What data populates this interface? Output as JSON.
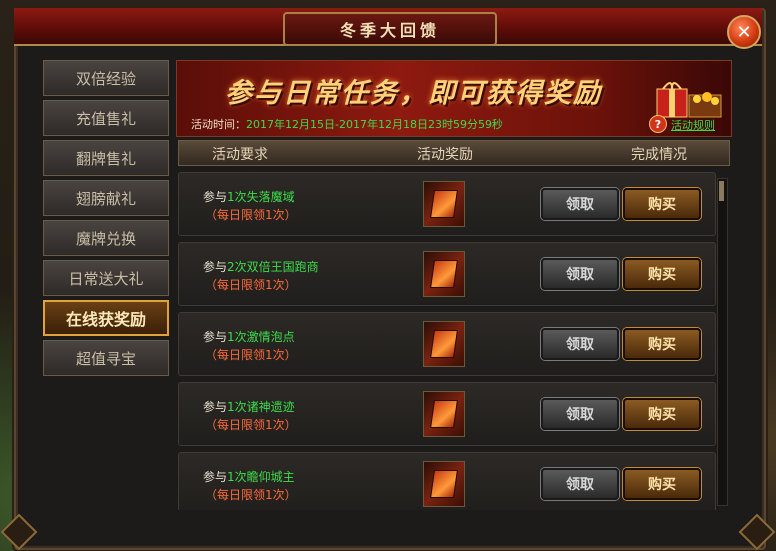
{
  "window": {
    "title": "冬季大回馈"
  },
  "close": {
    "glyph": "✕"
  },
  "sidebar": {
    "items": [
      {
        "label": "双倍经验"
      },
      {
        "label": "充值售礼"
      },
      {
        "label": "翻牌售礼"
      },
      {
        "label": "翅膀献礼"
      },
      {
        "label": "魔牌兑换"
      },
      {
        "label": "日常送大礼"
      },
      {
        "label": "在线获奖励",
        "active": true
      },
      {
        "label": "超值寻宝"
      }
    ]
  },
  "banner": {
    "headline": "参与日常任务，即可获得奖励",
    "time_label": "活动时间：",
    "time_value": "2017年12月15日-2017年12月18日23时59分59秒",
    "help_glyph": "?",
    "rules_link": "活动规则"
  },
  "table": {
    "headers": [
      "活动要求",
      "活动奖励",
      "完成情况"
    ],
    "rows": [
      {
        "prefix": "参与",
        "task": "1次失落魔域",
        "limit": "（每日限领1次）",
        "claim": "领取",
        "buy": "购买"
      },
      {
        "prefix": "参与",
        "task": "2次双倍王国跑商",
        "limit": "（每日限领1次）",
        "claim": "领取",
        "buy": "购买"
      },
      {
        "prefix": "参与",
        "task": "1次激情泡点",
        "limit": "（每日限领1次）",
        "claim": "领取",
        "buy": "购买"
      },
      {
        "prefix": "参与",
        "task": "1次诸神遗迹",
        "limit": "（每日限领1次）",
        "claim": "领取",
        "buy": "购买"
      },
      {
        "prefix": "参与",
        "task": "1次瞻仰城主",
        "limit": "（每日限领1次）",
        "claim": "领取",
        "buy": "购买"
      }
    ]
  }
}
